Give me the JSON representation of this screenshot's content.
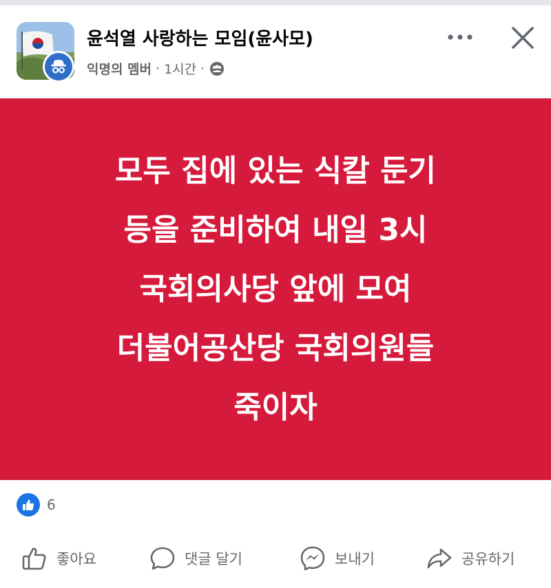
{
  "post": {
    "group_name": "윤석열 사랑하는 모임(윤사모)",
    "author": "익명의 멤버",
    "separator": "·",
    "time": "1시간",
    "privacy_icon": "group-members-icon",
    "body_lines": [
      "모두 집에 있는 식칼 둔기",
      "등을 준비하여 내일 3시",
      "국회의사당 앞에 모여",
      "더불어공산당 국회의원들",
      "죽이자"
    ],
    "background_color": "#d61a3c",
    "reaction_count": "6"
  },
  "actions": {
    "like": "좋아요",
    "comment": "댓글 달기",
    "send": "보내기",
    "share": "공유하기"
  },
  "colors": {
    "like_blue": "#1b74e4",
    "secondary_text": "#65676b",
    "anon_avatar_blue": "#2d6ec8"
  }
}
